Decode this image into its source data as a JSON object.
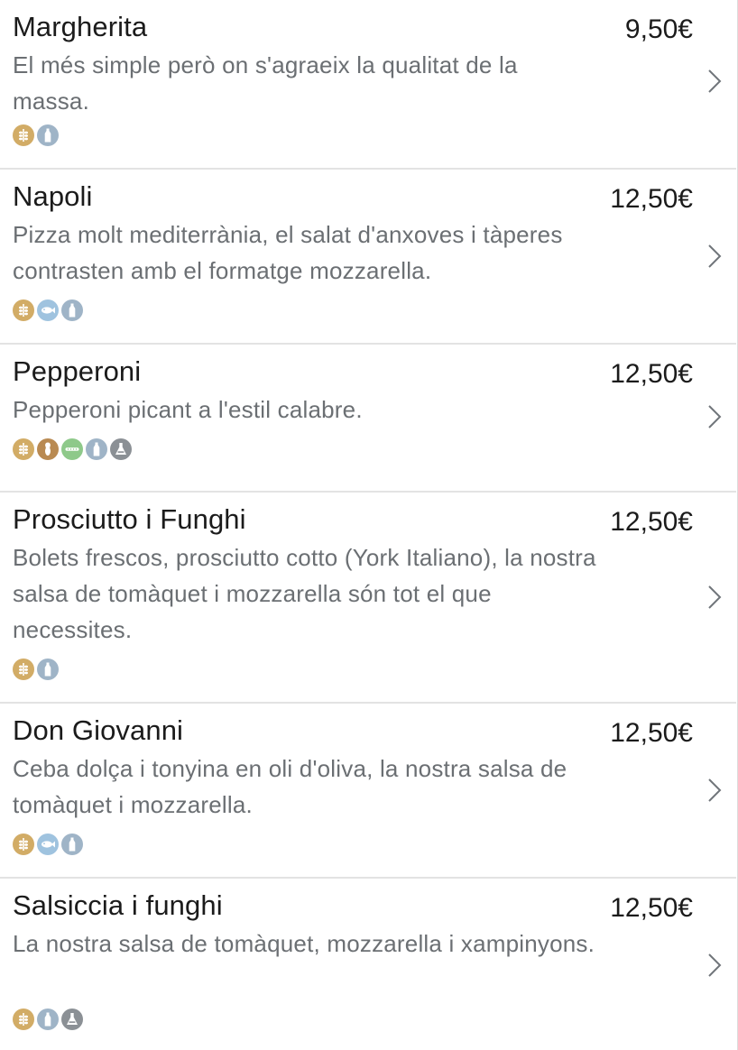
{
  "menu": {
    "items": [
      {
        "name": "Margherita",
        "price": "9,50€",
        "description": "El més simple però on s'agraeix la qualitat de la massa.",
        "allergens": [
          "gluten-icon",
          "milk-icon"
        ]
      },
      {
        "name": "Napoli",
        "price": "12,50€",
        "description": "Pizza molt mediterrània, el salat d'anxoves i tàperes contrasten amb el formatge mozzarella.",
        "allergens": [
          "gluten-icon",
          "fish-icon",
          "milk-icon"
        ]
      },
      {
        "name": "Pepperoni",
        "price": "12,50€",
        "description": "Pepperoni picant a l'estil calabre.",
        "allergens": [
          "gluten-icon",
          "peanut-icon",
          "celery-icon",
          "milk-icon",
          "sulphites-icon"
        ]
      },
      {
        "name": "Prosciutto i Funghi",
        "price": "12,50€",
        "description": "Bolets frescos, prosciutto cotto (York Italiano), la nostra salsa de tomàquet i mozzarella són tot el que necessites.",
        "allergens": [
          "gluten-icon",
          "milk-icon"
        ]
      },
      {
        "name": "Don Giovanni",
        "price": "12,50€",
        "description": "Ceba dolça i tonyina en oli d'oliva, la nostra salsa de tomàquet i mozzarella.",
        "allergens": [
          "gluten-icon",
          "fish-icon",
          "milk-icon"
        ]
      },
      {
        "name": "Salsiccia i funghi",
        "price": "12,50€",
        "description": "La nostra salsa de tomàquet, mozzarella i xampinyons.",
        "allergens": [
          "gluten-icon",
          "milk-icon",
          "sulphites-icon"
        ]
      }
    ]
  },
  "colors": {
    "gluten": "#d2ac66",
    "milk": "#9fb4c7",
    "fish": "#9fc3df",
    "peanut": "#b98a52",
    "celery": "#8ec98a",
    "sulphites": "#8b9095"
  }
}
